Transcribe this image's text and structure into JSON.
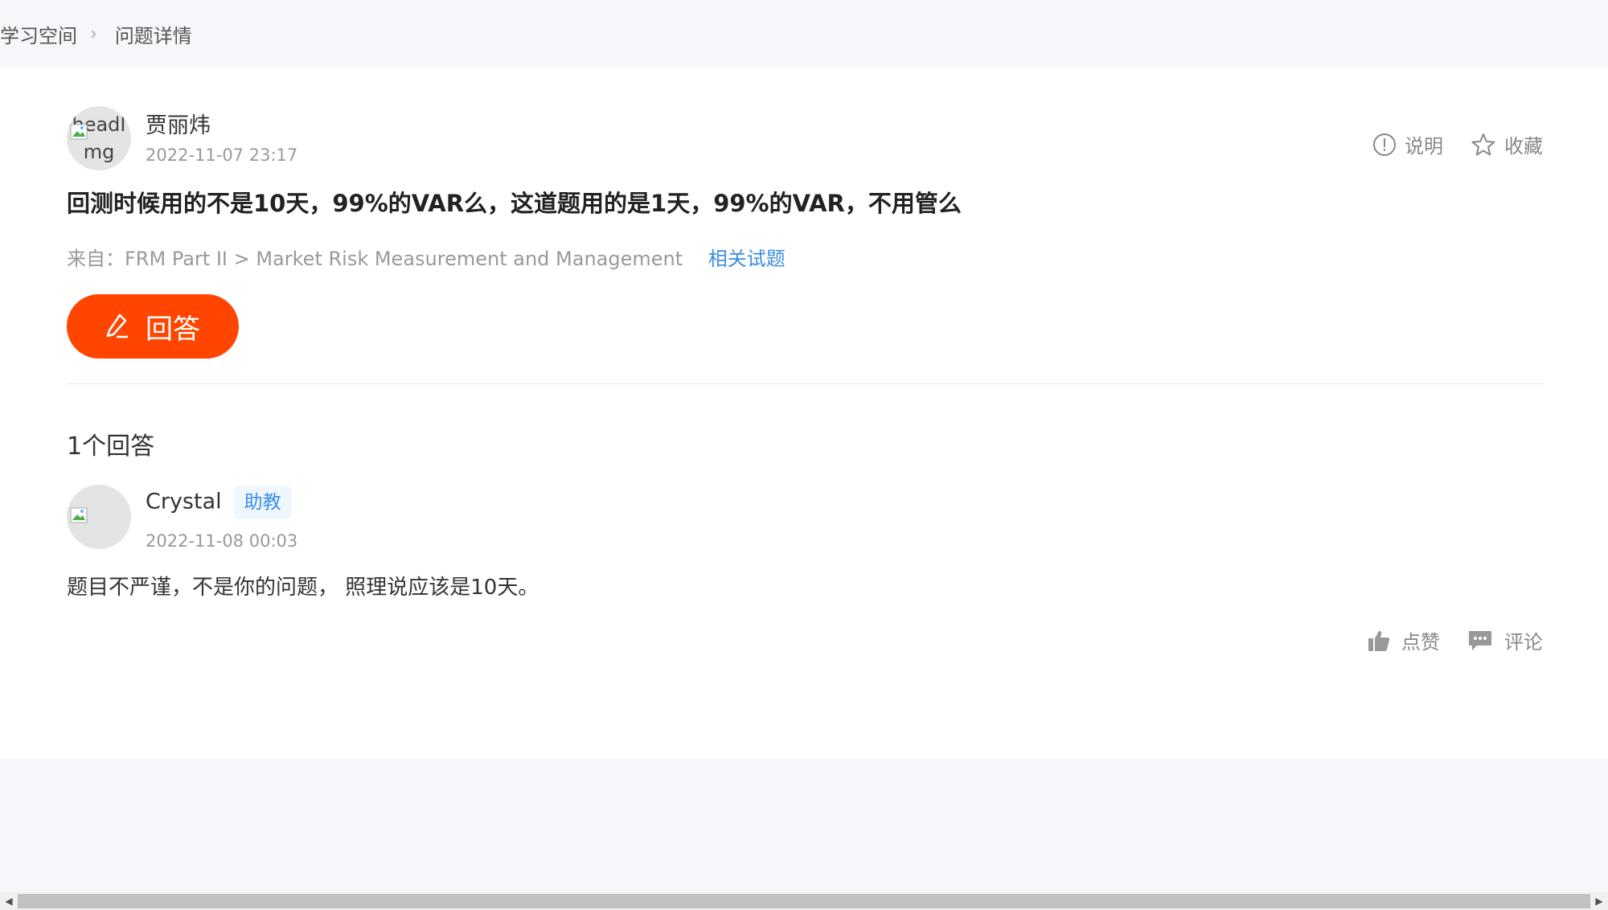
{
  "breadcrumb": {
    "home": "学习空间",
    "current": "问题详情"
  },
  "question": {
    "avatar_alt": "headImg",
    "author": "贾丽炜",
    "time": "2022-11-07 23:17",
    "title": "回测时候用的不是10天，99%的VAR么，这道题用的是1天，99%的VAR，不用管么",
    "source_prefix": "来自：",
    "source_path": "FRM Part II > Market Risk Measurement and Management",
    "related_link": "相关试题",
    "explain_label": "说明",
    "favorite_label": "收藏",
    "answer_button": "回答"
  },
  "answers_count": "1个回答",
  "answer": {
    "author": "Crystal",
    "role_badge": "助教",
    "time": "2022-11-08 00:03",
    "text": "题目不严谨，不是你的问题， 照理说应该是10天。",
    "like_label": "点赞",
    "comment_label": "评论"
  },
  "colors": {
    "accent": "#ff4500",
    "link": "#3a8ee6"
  }
}
